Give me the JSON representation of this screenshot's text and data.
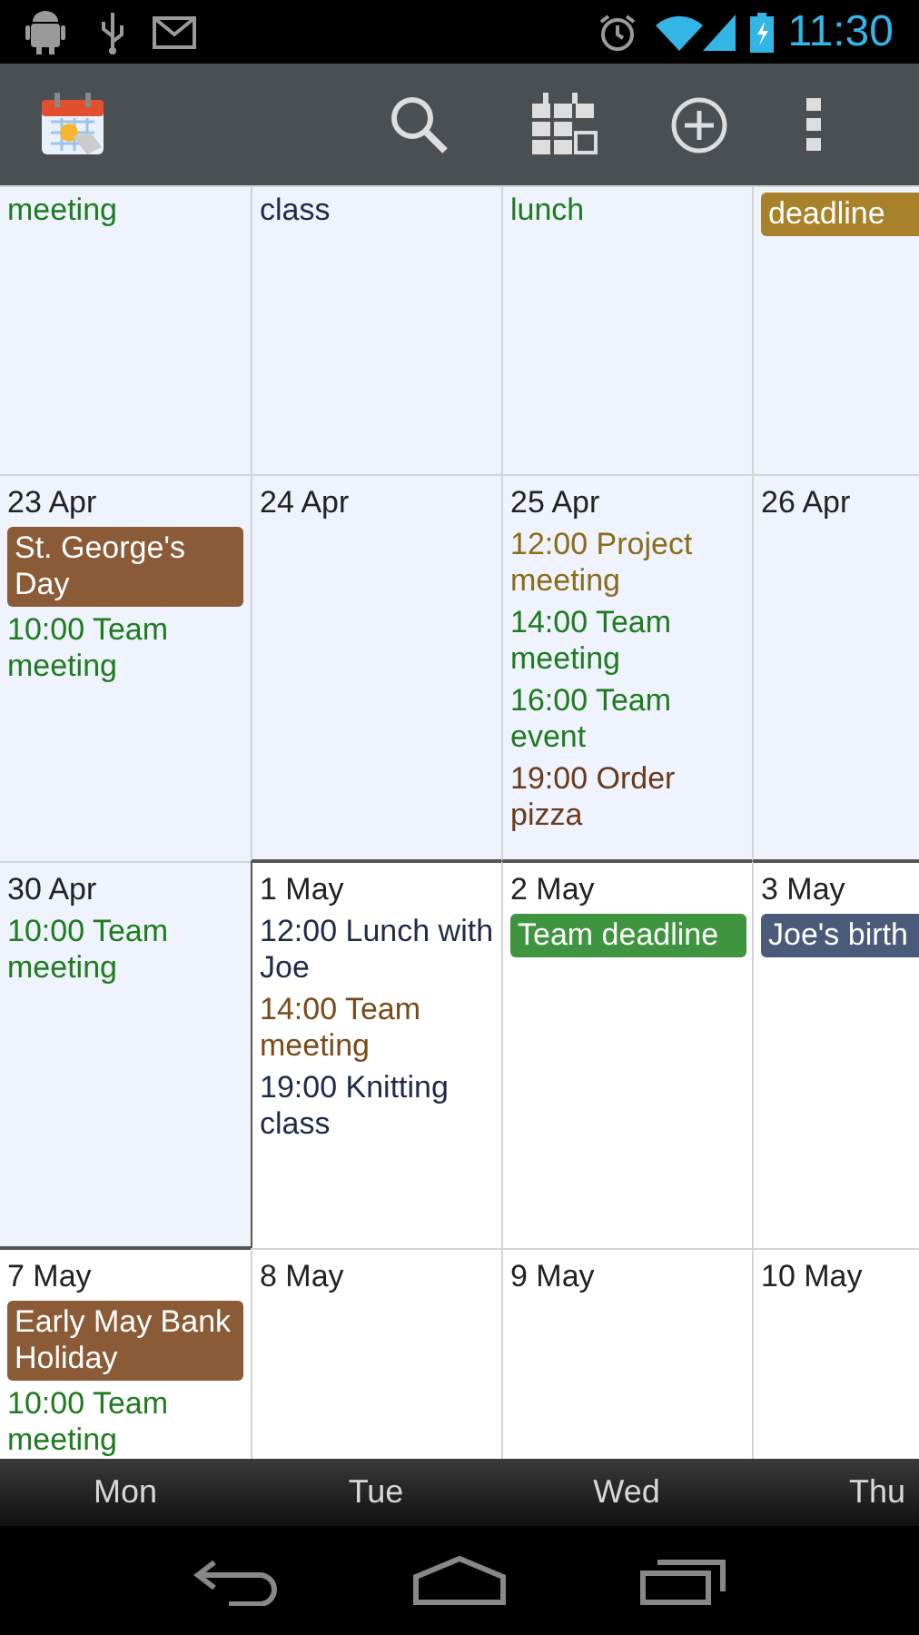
{
  "status_bar": {
    "time": "11:30"
  },
  "weeks": [
    {
      "days": [
        {
          "current_month": false,
          "events": [
            {
              "kind": "timed",
              "text": "meeting",
              "color": "#1e7b1e"
            }
          ]
        },
        {
          "current_month": false,
          "events": [
            {
              "kind": "timed",
              "text": "class",
              "color": "#1f2a4a"
            }
          ]
        },
        {
          "current_month": false,
          "events": [
            {
              "kind": "timed",
              "text": "lunch",
              "color": "#1e7b1e"
            }
          ]
        },
        {
          "current_month": false,
          "events": [
            {
              "kind": "chip",
              "text": "deadline",
              "color": "#a8822a"
            }
          ]
        }
      ]
    },
    {
      "days": [
        {
          "date": "23 Apr",
          "current_month": false,
          "events": [
            {
              "kind": "chip",
              "text": "St. George's Day",
              "color": "#8b5a36"
            },
            {
              "kind": "timed",
              "text": "10:00 Team meeting",
              "color": "#1e7b1e"
            }
          ]
        },
        {
          "date": "24 Apr",
          "current_month": false
        },
        {
          "date": "25 Apr",
          "current_month": false,
          "events": [
            {
              "kind": "timed",
              "text": "12:00 Project meeting",
              "color": "#8a6d1a"
            },
            {
              "kind": "timed",
              "text": "14:00 Team meeting",
              "color": "#1e7b1e"
            },
            {
              "kind": "timed",
              "text": "16:00 Team event",
              "color": "#1e7b1e"
            },
            {
              "kind": "timed",
              "text": "19:00 Order pizza",
              "color": "#6b3a1a"
            }
          ]
        },
        {
          "date": "26 Apr",
          "current_month": false
        }
      ]
    },
    {
      "days": [
        {
          "date": "30 Apr",
          "current_month": false,
          "events": [
            {
              "kind": "timed",
              "text": "10:00 Team meeting",
              "color": "#1e7b1e"
            }
          ]
        },
        {
          "date": "1 May",
          "current_month": true,
          "events": [
            {
              "kind": "timed",
              "text": "12:00 Lunch with Joe",
              "color": "#1f2a4a"
            },
            {
              "kind": "timed",
              "text": "14:00 Team meeting",
              "color": "#7a4a1a"
            },
            {
              "kind": "timed",
              "text": "19:00 Knitting class",
              "color": "#1f2a4a"
            }
          ]
        },
        {
          "date": "2 May",
          "current_month": true,
          "events": [
            {
              "kind": "chip",
              "text": "Team deadline",
              "color": "#3f9440"
            }
          ]
        },
        {
          "date": "3 May",
          "current_month": true,
          "events": [
            {
              "kind": "chip",
              "text": "Joe's birth",
              "color": "#4a5a7a"
            }
          ]
        }
      ]
    },
    {
      "days": [
        {
          "date": "7 May",
          "current_month": true,
          "events": [
            {
              "kind": "chip",
              "text": "Early May Bank Holiday",
              "color": "#8b5a36"
            },
            {
              "kind": "timed",
              "text": "10:00 Team meeting",
              "color": "#1e7b1e"
            }
          ]
        },
        {
          "date": "8 May",
          "current_month": true
        },
        {
          "date": "9 May",
          "current_month": true
        },
        {
          "date": "10 May",
          "current_month": true
        }
      ]
    }
  ],
  "weekdays": [
    "Mon",
    "Tue",
    "Wed",
    "Thu"
  ]
}
